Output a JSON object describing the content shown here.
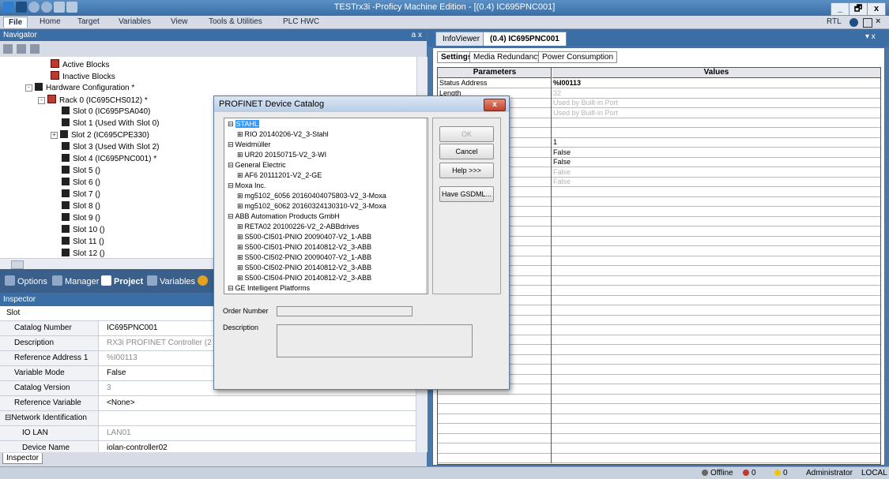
{
  "window": {
    "title": "TESTrx3i -Proficy Machine Edition - [(0.4) IC695PNC001]",
    "min": "_",
    "max": "🗗",
    "close": "x"
  },
  "menu": [
    "File",
    "Home",
    "Target",
    "Variables",
    "View",
    "Tools & Utilities",
    "PLC HWC"
  ],
  "menu_right": {
    "rtl": "RTL"
  },
  "navigator": {
    "title": "Navigator",
    "pin": "a x",
    "tree": [
      {
        "label": "Active Blocks"
      },
      {
        "label": "Inactive Blocks"
      },
      {
        "label": "Hardware Configuration *"
      },
      {
        "label": "Rack 0 (IC695CHS012) *"
      },
      {
        "label": "Slot 0 (IC695PSA040)"
      },
      {
        "label": "Slot 1 (Used With Slot 0)"
      },
      {
        "label": "Slot 2 (IC695CPE330)"
      },
      {
        "label": "Slot 3 (Used With Slot 2)"
      },
      {
        "label": "Slot 4 (IC695PNC001) *"
      },
      {
        "label": "Slot 5 ()"
      },
      {
        "label": "Slot 6 ()"
      },
      {
        "label": "Slot 7 ()"
      },
      {
        "label": "Slot 8 ()"
      },
      {
        "label": "Slot 9 ()"
      },
      {
        "label": "Slot 10 ()"
      },
      {
        "label": "Slot 11 ()"
      },
      {
        "label": "Slot 12 ()"
      }
    ],
    "tabs": [
      "Options",
      "Manager",
      "Project",
      "Variables"
    ]
  },
  "inspector": {
    "title": "Inspector",
    "section": "Slot",
    "rows": [
      {
        "label": "Catalog Number",
        "value": "IC695PNC001"
      },
      {
        "label": "Description",
        "value": "RX3i PROFINET Controller (2 SF"
      },
      {
        "label": "Reference Address 1",
        "value": "%I00113"
      },
      {
        "label": "Variable Mode",
        "value": "False"
      },
      {
        "label": "Catalog Version",
        "value": "3"
      },
      {
        "label": "Reference Variable",
        "value": "<None>"
      },
      {
        "label": "⊟Network Identification",
        "value": ""
      },
      {
        "label": "IO LAN",
        "value": "LAN01"
      },
      {
        "label": "Device Name",
        "value": "iolan-controller02"
      }
    ],
    "bottom_tab": "Inspector"
  },
  "right_pane": {
    "tabs": [
      "InfoViewer",
      "(0.4) IC695PNC001"
    ],
    "pin": "▾ x",
    "subtabs": [
      "Settings",
      "Media Redundancy",
      "Power Consumption"
    ],
    "headers": [
      "Parameters",
      "Values"
    ],
    "rows": [
      {
        "name": "Status Address",
        "value": "%I00113",
        "bold": true
      },
      {
        "name": "Length",
        "value": "32",
        "grey": true
      },
      {
        "name": "",
        "value": "Used by Built-in Port",
        "grey": true
      },
      {
        "name": "",
        "value": "Used by Built-in Port",
        "grey": true
      },
      {
        "name": "",
        "value": ""
      },
      {
        "name": "",
        "value": ""
      },
      {
        "name": "",
        "value": "1"
      },
      {
        "name": "",
        "value": "False"
      },
      {
        "name": "",
        "value": "False"
      },
      {
        "name": "",
        "value": "False",
        "grey": true
      },
      {
        "name": "",
        "value": "False",
        "grey": true
      }
    ]
  },
  "dialog": {
    "title": "PROFINET Device Catalog",
    "close": "x",
    "tree": [
      {
        "text": "STAHL",
        "level": 0,
        "exp": "⊟",
        "selected": true
      },
      {
        "text": "RIO 20140206-V2_3-Stahl",
        "level": 1,
        "exp": "⊞"
      },
      {
        "text": "Weidmüller",
        "level": 0,
        "exp": "⊟"
      },
      {
        "text": "UR20 20150715-V2_3-WI",
        "level": 1,
        "exp": "⊞"
      },
      {
        "text": "General Electric",
        "level": 0,
        "exp": "⊟"
      },
      {
        "text": "AF6 20111201-V2_2-GE",
        "level": 1,
        "exp": "⊞"
      },
      {
        "text": "Moxa Inc.",
        "level": 0,
        "exp": "⊟"
      },
      {
        "text": "mg5102_6056 20160404075803-V2_3-Moxa",
        "level": 1,
        "exp": "⊞"
      },
      {
        "text": "mg5102_6062 20160324130310-V2_3-Moxa",
        "level": 1,
        "exp": "⊞"
      },
      {
        "text": "ABB Automation Products GmbH",
        "level": 0,
        "exp": "⊟"
      },
      {
        "text": "RETA02 20100226-V2_2-ABBdrives",
        "level": 1,
        "exp": "⊞"
      },
      {
        "text": "S500-CI501-PNIO 20090407-V2_1-ABB",
        "level": 1,
        "exp": "⊞"
      },
      {
        "text": "S500-CI501-PNIO 20140812-V2_3-ABB",
        "level": 1,
        "exp": "⊞"
      },
      {
        "text": "S500-CI502-PNIO 20090407-V2_1-ABB",
        "level": 1,
        "exp": "⊞"
      },
      {
        "text": "S500-CI502-PNIO 20140812-V2_3-ABB",
        "level": 1,
        "exp": "⊞"
      },
      {
        "text": "S500-CI504-PNIO 20140812-V2_3-ABB",
        "level": 1,
        "exp": "⊞"
      },
      {
        "text": "GE Intelligent Platforms",
        "level": 0,
        "exp": "⊟"
      }
    ],
    "buttons": {
      "ok": "OK",
      "cancel": "Cancel",
      "help": "Help >>>",
      "gsdml": "Have GSDML..."
    },
    "order_number_label": "Order Number",
    "description_label": "Description"
  },
  "status": {
    "offline": "Offline",
    "errors": "0",
    "warnings": "0",
    "user": "Administrator",
    "location": "LOCAL"
  },
  "colors": {
    "accent": "#3a6ea5",
    "selection": "#3399ff",
    "error": "#c0392b",
    "warning": "#f1c40f"
  }
}
